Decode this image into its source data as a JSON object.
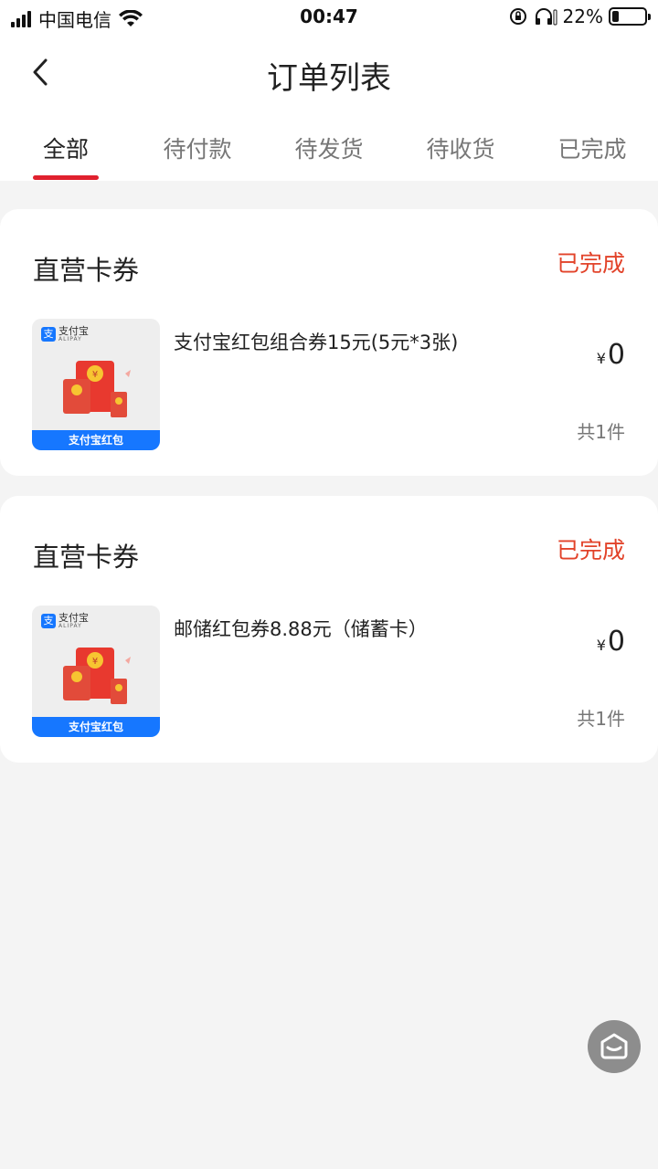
{
  "status_bar": {
    "carrier": "中国电信",
    "time": "00:47",
    "battery": "22%",
    "battery_level": 0.22
  },
  "nav": {
    "title": "订单列表"
  },
  "tabs": [
    {
      "label": "全部",
      "active": true
    },
    {
      "label": "待付款",
      "active": false
    },
    {
      "label": "待发货",
      "active": false
    },
    {
      "label": "待收货",
      "active": false
    },
    {
      "label": "已完成",
      "active": false
    }
  ],
  "orders": [
    {
      "shop": "直营卡券",
      "status": "已完成",
      "product_name": "支付宝红包组合券15元(5元*3张)",
      "currency": "¥",
      "price": "0",
      "count": "共1件",
      "thumb_logo": "支付宝",
      "thumb_logo_sub": "ALIPAY",
      "thumb_banner": "支付宝红包"
    },
    {
      "shop": "直营卡券",
      "status": "已完成",
      "product_name": "邮储红包券8.88元（储蓄卡）",
      "currency": "¥",
      "price": "0",
      "count": "共1件",
      "thumb_logo": "支付宝",
      "thumb_logo_sub": "ALIPAY",
      "thumb_banner": "支付宝红包"
    }
  ],
  "colors": {
    "accent": "#e0212e",
    "status": "#e2432a",
    "alipay_blue": "#1677ff"
  }
}
